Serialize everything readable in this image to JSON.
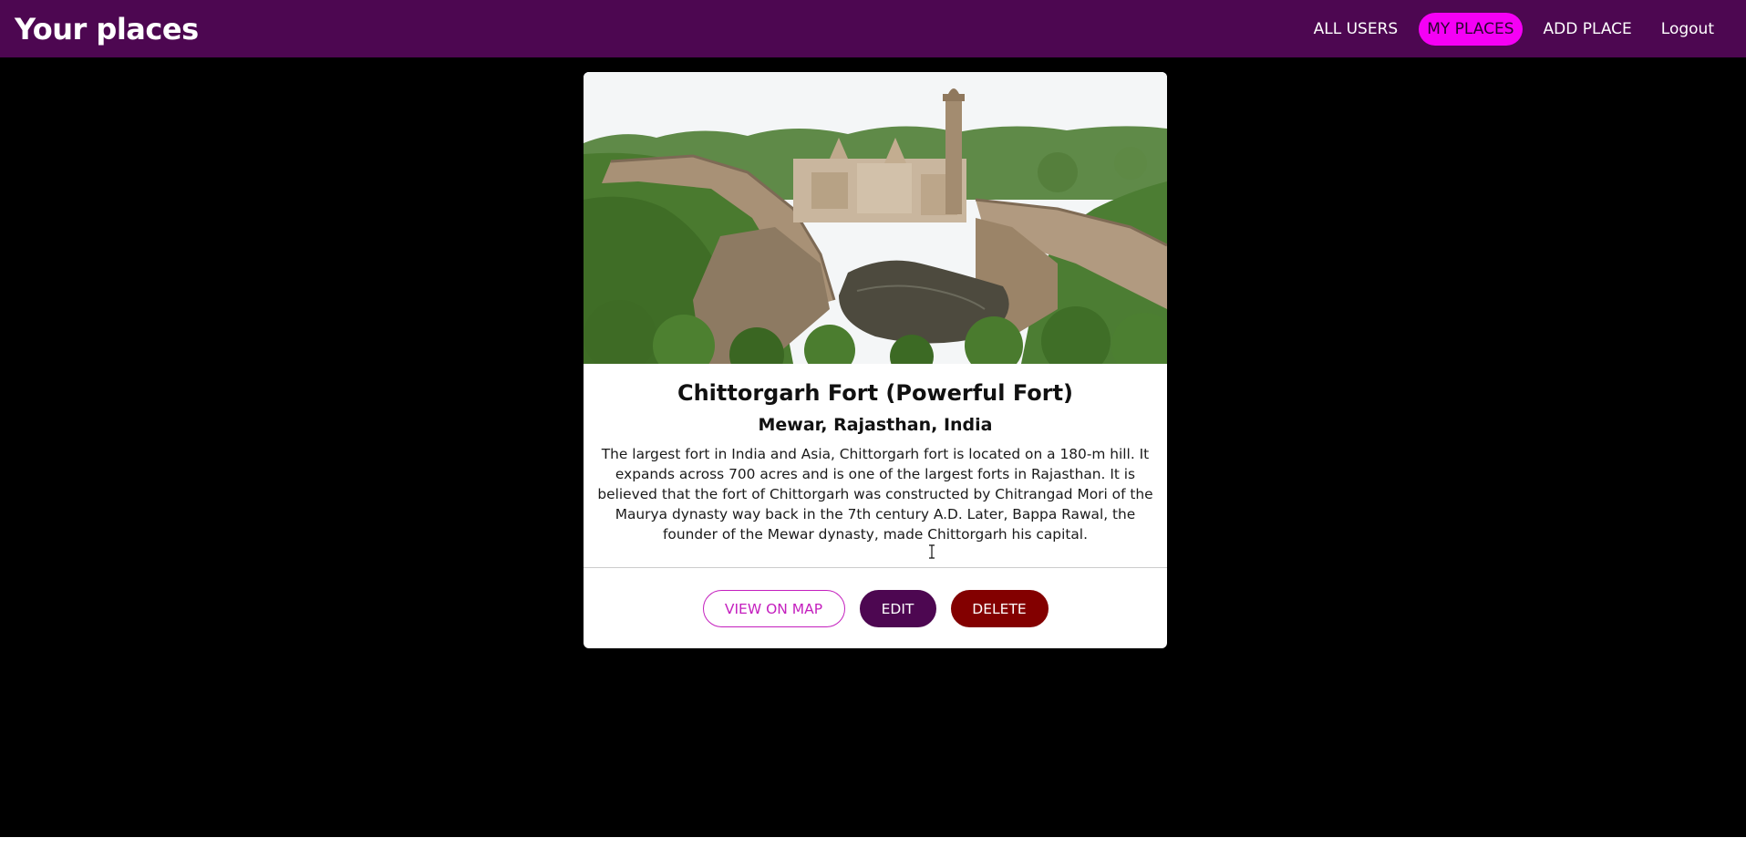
{
  "header": {
    "title": "Your places",
    "nav": [
      {
        "label": "ALL USERS",
        "active": false
      },
      {
        "label": "MY PLACES",
        "active": true
      },
      {
        "label": "ADD PLACE",
        "active": false
      },
      {
        "label": "Logout",
        "active": false
      }
    ]
  },
  "place": {
    "title": "Chittorgarh Fort (Powerful Fort)",
    "address": "Mewar, Rajasthan, India",
    "description": "The largest fort in India and Asia, Chittorgarh fort is located on a 180-m hill. It expands across 700 acres and is one of the largest forts in Rajasthan. It is believed that the fort of Chittorgarh was constructed by Chitrangad Mori of the Maurya dynasty way back in the 7th century A.D. Later, Bappa Rawal, the founder of the Mewar dynasty, made Chittorgarh his capital."
  },
  "actions": {
    "view_on_map": "VIEW ON MAP",
    "edit": "EDIT",
    "delete": "DELETE"
  },
  "colors": {
    "header_bg": "#4d0751",
    "active_nav": "#f500f5",
    "view_button": "#c41fbe",
    "delete_button": "#830000"
  }
}
